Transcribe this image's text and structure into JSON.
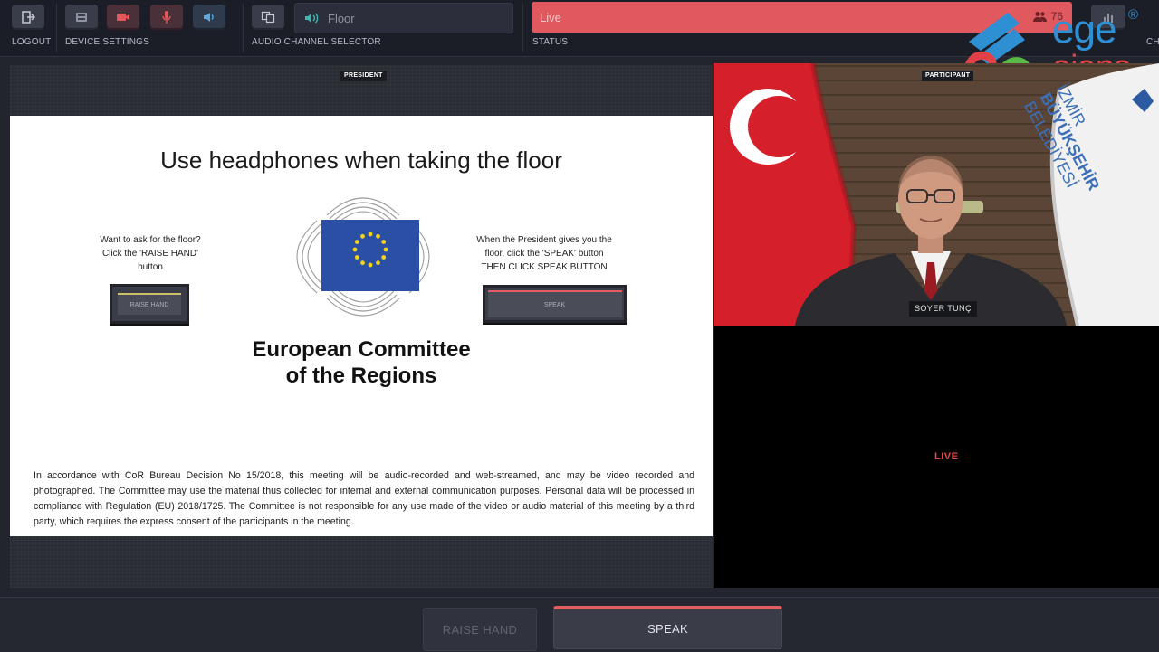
{
  "toolbar": {
    "logout_label": "LOGOUT",
    "device_settings_label": "DEVICE SETTINGS",
    "audio_channel_label": "AUDIO CHANNEL SELECTOR",
    "channel_value": "Floor",
    "status_label": "STATUS",
    "status_value": "Live",
    "participant_count": "76",
    "clipped_label": "CH"
  },
  "watermark": {
    "line1": "ege",
    "line2": "ajans",
    "registered": "®"
  },
  "stage": {
    "president_tag": "PRESIDENT",
    "participant_tag": "PARTICIPANT"
  },
  "slide": {
    "title": "Use headphones when taking the floor",
    "left_text": [
      "Want to ask for the floor?",
      "Click the 'RAISE HAND'",
      "button"
    ],
    "left_button": "RAISE HAND",
    "right_text": [
      "When the President gives you the",
      "floor, click the 'SPEAK' button",
      "THEN CLICK SPEAK BUTTON"
    ],
    "right_button": "SPEAK",
    "org_name_line1": "European Committee",
    "org_name_line2": "of the Regions",
    "disclaimer": "In accordance with CoR Bureau Decision No 15/2018, this meeting will be audio-recorded and web-streamed, and may be video recorded and photographed. The Committee may use the material thus collected for internal and external communication purposes. Personal data will be processed in compliance with Regulation (EU) 2018/1725. The Committee is not responsible for any use made of the video or audio material of this meeting by a third party, which requires the express consent of the participants in the meeting."
  },
  "video": {
    "speaker_name": "SOYER TUNÇ",
    "banner_text": [
      "İZMİR",
      "BÜYÜKŞEHİR",
      "BELEDİYESİ"
    ],
    "live_label": "LIVE"
  },
  "bottom": {
    "raise_hand": "RAISE HAND",
    "speak": "SPEAK"
  },
  "colors": {
    "status_red": "#e0595e",
    "accent_red": "#e25d62",
    "teal_icon": "#3fb6b0",
    "eu_blue": "#2a4fa5",
    "eu_star": "#f2d21d"
  }
}
